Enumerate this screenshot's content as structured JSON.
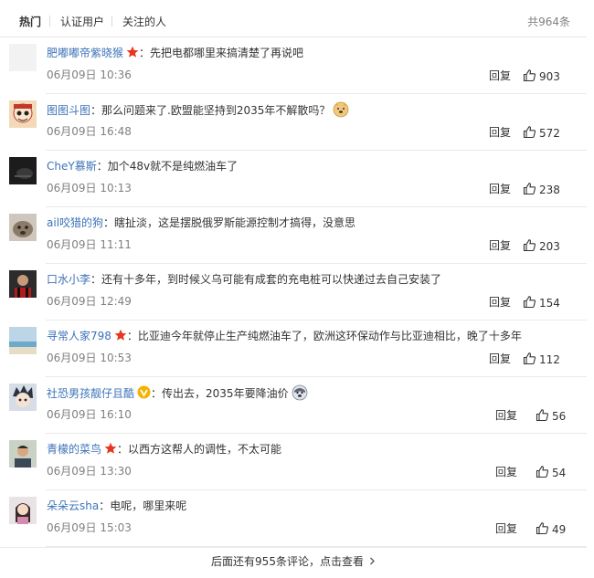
{
  "tabs": [
    "热门",
    "认证用户",
    "关注的人"
  ],
  "total_label": "共964条",
  "reply_label": "回复",
  "more_label": "后面还有955条评论，点击查看",
  "colors": {
    "orange_name": "#eb7350",
    "blue_name": "#3d73b8",
    "badge_red": "#e8351c",
    "badge_gold": "#f5b300"
  },
  "comments": [
    {
      "user": "肥嘟嘟帝紫晓猴",
      "badge": "red-star",
      "text": "先把电都哪里来搞清楚了再说吧",
      "time": "06月09日 10:36",
      "likes": "903",
      "avatar": "blank-avatar"
    },
    {
      "user": "图图斗图",
      "badge": "",
      "text": "那么问题来了.欧盟能坚持到2035年不解散吗？",
      "emoji": "doge-emoji",
      "time": "06月09日 16:48",
      "likes": "572",
      "avatar": "cartoon-avatar"
    },
    {
      "user": "CheY慕斯",
      "badge": "",
      "text": "加个48v就不是纯燃油车了",
      "time": "06月09日 10:13",
      "likes": "238",
      "avatar": "dark-avatar"
    },
    {
      "user": "ail咬猎的狗",
      "badge": "",
      "text": "瞎扯淡，这是摆脱俄罗斯能源控制才搞得，没意思",
      "time": "06月09日 11:11",
      "likes": "203",
      "avatar": "dog-avatar"
    },
    {
      "user": "口水小李",
      "badge": "",
      "text": "还有十多年，到时候义乌可能有成套的充电桩可以快递过去自己安装了",
      "time": "06月09日 12:49",
      "likes": "154",
      "avatar": "person-avatar"
    },
    {
      "user": "寻常人家798",
      "badge": "red-star",
      "text": "比亚迪今年就停止生产纯燃油车了，欧洲这环保动作与比亚迪相比，晚了十多年",
      "time": "06月09日 10:53",
      "likes": "112",
      "avatar": "beach-avatar"
    },
    {
      "user": "社恐男孩靓仔且酷",
      "badge": "gold-v",
      "text": "传出去，2035年要降油价",
      "emoji": "husky-emoji",
      "time": "06月09日 16:10",
      "likes": "56",
      "avatar": "anime-avatar"
    },
    {
      "user": "青檬的菜鸟",
      "badge": "red-star",
      "text": "以西方这帮人的调性，不太可能",
      "time": "06月09日 13:30",
      "likes": "54",
      "avatar": "man-avatar"
    },
    {
      "user": "朵朵云sha",
      "badge": "",
      "text": "电呢，哪里来呢",
      "time": "06月09日 15:03",
      "likes": "49",
      "avatar": "girl-avatar"
    }
  ]
}
